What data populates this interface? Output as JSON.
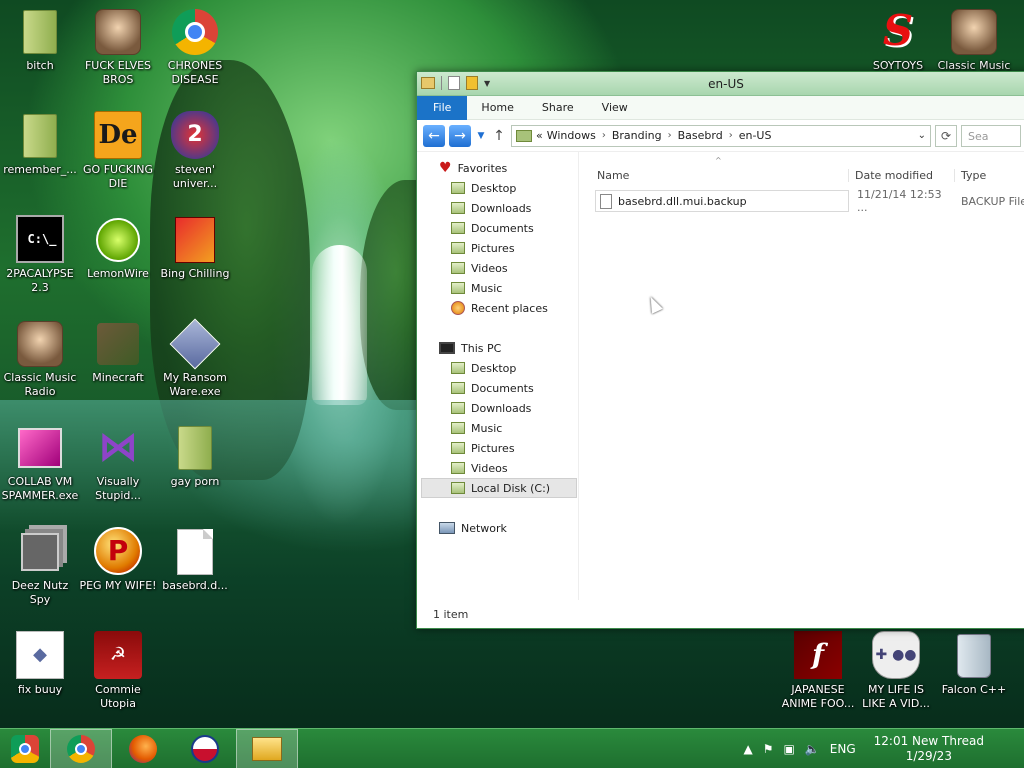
{
  "desktop": {
    "icons": [
      {
        "label": "bitch"
      },
      {
        "label": "FUCK ELVES BROS"
      },
      {
        "label": "CHRONES DISEASE"
      },
      {
        "label": "remember_..."
      },
      {
        "label": "GO FUCKING DIE"
      },
      {
        "label": "steven' univer..."
      },
      {
        "label": "2PACALYPSE 2.3"
      },
      {
        "label": "LemonWire"
      },
      {
        "label": "Bing Chilling"
      },
      {
        "label": "Classic Music Radio"
      },
      {
        "label": "Minecraft"
      },
      {
        "label": "My Ransom Ware.exe"
      },
      {
        "label": "COLLAB VM SPAMMER.exe"
      },
      {
        "label": "Visually Stupid..."
      },
      {
        "label": "gay porn"
      },
      {
        "label": "Deez Nutz Spy"
      },
      {
        "label": "PEG MY WIFE!"
      },
      {
        "label": "basebrd.d..."
      },
      {
        "label": "fix buuy"
      },
      {
        "label": "Commie Utopia"
      },
      {
        "label": "SOYTOYS"
      },
      {
        "label": "Classic Music"
      },
      {
        "label": "JAPANESE ANIME FOO..."
      },
      {
        "label": "MY LIFE IS LIKE A VID..."
      },
      {
        "label": "Falcon C++"
      }
    ],
    "glyphs": {
      "de": "De",
      "steven": "2",
      "cmd": "C:\\_",
      "vs": "⋈",
      "peg": "P",
      "fix": "◆",
      "commie": "☭",
      "soy": "S",
      "flash": "f",
      "pad": "✚ ●●"
    }
  },
  "window": {
    "title": "en-US",
    "tabs": [
      "File",
      "Home",
      "Share",
      "View"
    ],
    "nav": {
      "back": "←",
      "forward": "→",
      "dropdown": "▼",
      "up": "↑",
      "refresh": "⟳"
    },
    "address": {
      "prefix": "«",
      "crumbs": [
        "Windows",
        "Branding",
        "Basebrd",
        "en-US"
      ],
      "sep": "›",
      "dropdown": "⌄"
    },
    "search_placeholder": "Sea",
    "nav_pane": {
      "favorites_header": "Favorites",
      "favorites": [
        "Desktop",
        "Downloads",
        "Documents",
        "Pictures",
        "Videos",
        "Music",
        "Recent places"
      ],
      "thispc_header": "This PC",
      "thispc": [
        "Desktop",
        "Documents",
        "Downloads",
        "Music",
        "Pictures",
        "Videos",
        "Local Disk (C:)"
      ],
      "network": "Network"
    },
    "columns": {
      "name": "Name",
      "date": "Date modified",
      "type": "Type"
    },
    "sort_caret": "^",
    "files": [
      {
        "name": "basebrd.dll.mui.backup",
        "date": "11/21/14 12:53 ...",
        "type": "BACKUP File"
      }
    ],
    "status": "1 item"
  },
  "taskbar": {
    "tray": {
      "up_arrow": "▲",
      "flag": "⚑",
      "network": "▣",
      "volume": "🔈",
      "lang": "ENG"
    },
    "clock": {
      "time": "12:01 New Thread",
      "date": "1/29/23"
    }
  },
  "colors": {
    "accent": "#1b73c8",
    "taskbar": "#2a8a3c",
    "titlebar": "#cde9cf"
  }
}
